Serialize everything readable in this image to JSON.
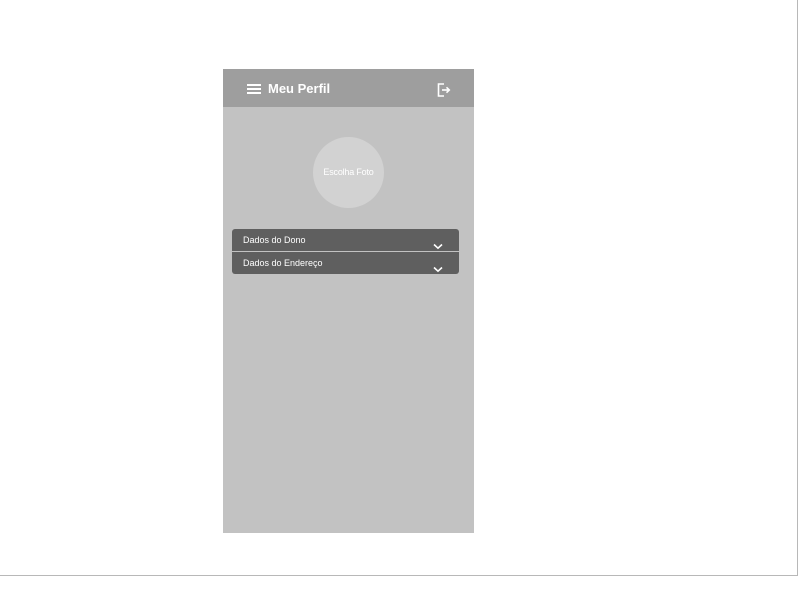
{
  "header": {
    "title": "Meu Perfil"
  },
  "profile": {
    "photo_label": "Escolha Foto"
  },
  "sections": [
    {
      "label": "Dados do Dono"
    },
    {
      "label": "Dados do Endereço"
    }
  ],
  "icons": {
    "menu": "hamburger-menu-icon",
    "logout": "logout-icon",
    "expand": "chevron-down-icon"
  },
  "colors": {
    "header": "#9e9e9e",
    "screen": "#c2c2c2",
    "avatar": "#d2d2d2",
    "accordion": "#5f5f5f"
  }
}
